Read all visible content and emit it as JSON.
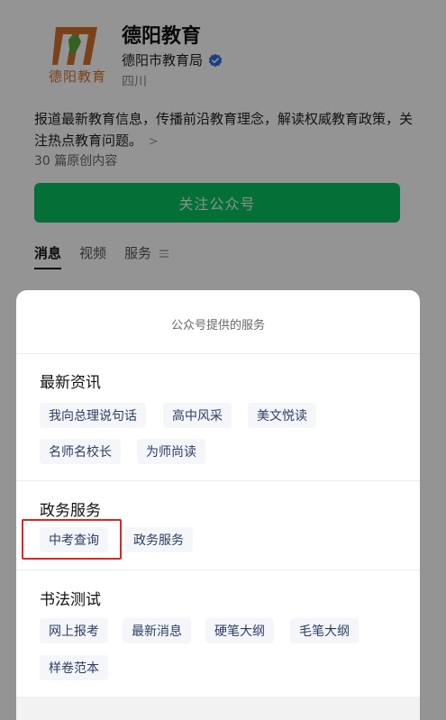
{
  "account": {
    "logo_text": "德阳教育",
    "name": "德阳教育",
    "org": "德阳市教育局",
    "region": "四川",
    "description": "报道最新教育信息，传播前沿教育理念，解读权威教育政策，关注热点教育问题。",
    "desc_chevron": ">",
    "original_count": "30 篇原创内容",
    "follow_label": "关注公众号"
  },
  "tabs": [
    {
      "label": "消息"
    },
    {
      "label": "视频"
    },
    {
      "label": "服务"
    }
  ],
  "sheet": {
    "title": "公众号提供的服务",
    "sections": [
      {
        "title": "最新资讯",
        "items": [
          "我向总理说句话",
          "高中风采",
          "美文悦读",
          "名师名校长",
          "为师尚读"
        ]
      },
      {
        "title": "政务服务",
        "items": [
          "中考查询",
          "政务服务"
        ]
      },
      {
        "title": "书法测试",
        "items": [
          "网上报考",
          "最新消息",
          "硬笔大纲",
          "毛笔大纲",
          "样卷范本"
        ]
      }
    ]
  },
  "colors": {
    "brand_green": "#07c160",
    "logo_orange": "#d5722c",
    "highlight_red": "#e02424",
    "verified_blue": "#2f6de0"
  }
}
